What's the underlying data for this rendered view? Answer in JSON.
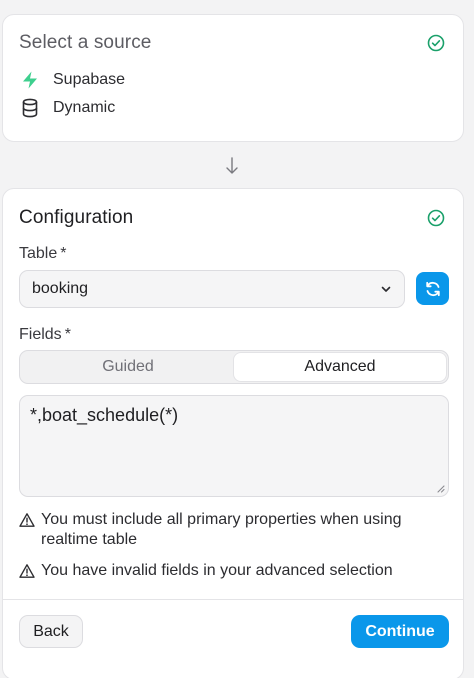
{
  "source_card": {
    "title": "Select a source",
    "sources": [
      {
        "label": "Supabase",
        "icon": "supabase-bolt-icon"
      },
      {
        "label": "Dynamic",
        "icon": "database-icon"
      }
    ]
  },
  "config_card": {
    "title": "Configuration",
    "table_label": "Table",
    "table_value": "booking",
    "fields_label": "Fields",
    "required_mark": "*",
    "tabs": [
      {
        "label": "Guided",
        "active": false
      },
      {
        "label": "Advanced",
        "active": true
      }
    ],
    "query_value": "*,boat_schedule(*)",
    "warnings": [
      "You must include all primary properties when using realtime table",
      "You have invalid fields in your advanced selection"
    ],
    "back_label": "Back",
    "continue_label": "Continue"
  },
  "colors": {
    "accent": "#0a97ea",
    "success": "#1aa06a",
    "supabase": "#3ecf8e"
  }
}
